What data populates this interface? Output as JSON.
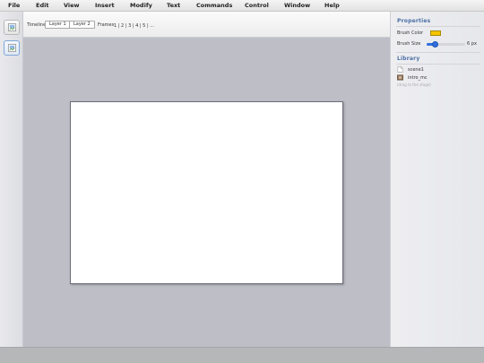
{
  "menu": [
    "File",
    "Edit",
    "View",
    "Insert",
    "Modify",
    "Text",
    "Commands",
    "Control",
    "Window",
    "Help"
  ],
  "toolbar": {
    "tools": [
      {
        "icon": "broken-image-icon",
        "active": false
      },
      {
        "icon": "broken-image-icon",
        "active": true
      }
    ]
  },
  "timeline": {
    "label": "Timeline",
    "layers": [
      "Layer 1",
      "Layer 2"
    ],
    "frames_label": "Frames",
    "frames": "1 | 2 | 3 | 4 | 5 | ..."
  },
  "properties": {
    "title": "Properties",
    "brush_color_label": "Brush Color",
    "brush_color": "#f5c400",
    "brush_size_label": "Brush Size",
    "brush_size_value": "6 px",
    "brush_size_fraction": 0.15
  },
  "library": {
    "title": "Library",
    "items": [
      {
        "name": "scene1",
        "icon": "document-icon"
      },
      {
        "name": "intro_mc",
        "icon": "movieclip-icon"
      }
    ],
    "hint": "(drag to the stage)"
  },
  "colors": {
    "accent": "#4a6fa5",
    "slider": "#2f6fdc"
  }
}
